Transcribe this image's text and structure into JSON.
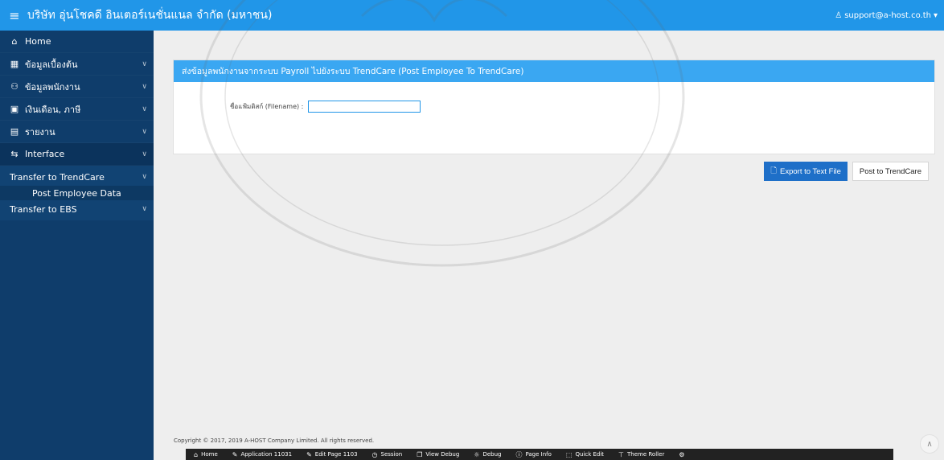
{
  "topbar": {
    "app_title": "บริษัท อุ่นโชคดี อินเตอร์เนชั่นแนล จำกัด (มหาชน)",
    "user_email": "support@a-host.co.th"
  },
  "sidebar": {
    "items": [
      {
        "label": "Home",
        "icon": "home-icon"
      },
      {
        "label": "ข้อมูลเบื้องต้น",
        "icon": "grid-icon"
      },
      {
        "label": "ข้อมูลพนักงาน",
        "icon": "users-icon"
      },
      {
        "label": "เงินเดือน, ภาษี",
        "icon": "money-icon"
      },
      {
        "label": "รายงาน",
        "icon": "report-icon"
      },
      {
        "label": "Interface",
        "icon": "swap-icon"
      }
    ],
    "interface_sub": {
      "transfer_trendcare": "Transfer to TrendCare",
      "post_employee_data": "Post Employee Data",
      "transfer_ebs": "Transfer to EBS"
    }
  },
  "panel": {
    "title": "ส่งข้อมูลพนักงานจากระบบ Payroll ไปยังระบบ TrendCare (Post Employee To TrendCare)",
    "filename_label": "ชื่อแฟ้มดิสก์ (Filename) :",
    "filename_value": "",
    "export_button": "Export to Text File",
    "post_button": "Post to TrendCare"
  },
  "footer": {
    "copyright": "Copyright © 2017, 2019 A-HOST Company Limited. All rights reserved."
  },
  "dev_toolbar": [
    {
      "label": "Home",
      "icon": "home-icon"
    },
    {
      "label": "Application 11031",
      "icon": "edit-icon"
    },
    {
      "label": "Edit Page 1103",
      "icon": "edit-icon"
    },
    {
      "label": "Session",
      "icon": "clock-icon"
    },
    {
      "label": "View Debug",
      "icon": "window-icon"
    },
    {
      "label": "Debug",
      "icon": "bug-icon"
    },
    {
      "label": "Page Info",
      "icon": "info-icon"
    },
    {
      "label": "Quick Edit",
      "icon": "cursor-icon"
    },
    {
      "label": "Theme Roller",
      "icon": "roller-icon"
    }
  ],
  "colors": {
    "topbar": "#2196e8",
    "sidebar": "#0f3d6b",
    "panel_header": "#3aa7f2",
    "primary_button": "#1e6fc8"
  }
}
